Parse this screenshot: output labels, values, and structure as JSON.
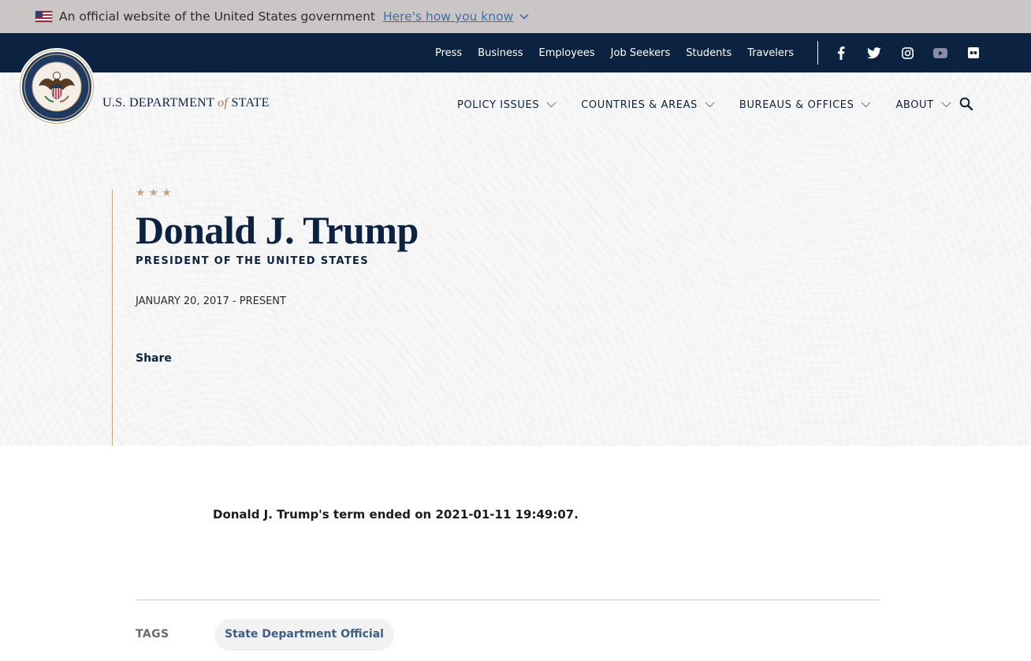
{
  "gov_banner": {
    "text": "An official website of the United States government",
    "link": "Here's how you know"
  },
  "utility_nav": {
    "links": [
      "Press",
      "Business",
      "Employees",
      "Job Seekers",
      "Students",
      "Travelers"
    ],
    "social_icons": [
      "facebook-icon",
      "twitter-icon",
      "instagram-icon",
      "youtube-icon",
      "flickr-icon"
    ]
  },
  "header": {
    "brand_prefix": "U.S. DEPARTMENT",
    "brand_of": "of",
    "brand_suffix": "STATE",
    "nav": [
      "POLICY ISSUES",
      "COUNTRIES & AREAS",
      "BUREAUS & OFFICES",
      "ABOUT"
    ]
  },
  "hero": {
    "stars": "★★★",
    "name": "Donald J. Trump",
    "title": "PRESIDENT OF THE UNITED STATES",
    "term": "JANUARY 20, 2017 - PRESENT",
    "share": "Share"
  },
  "body": {
    "term_ended": "Donald J. Trump's term ended on 2021-01-11 19:49:07."
  },
  "tags": {
    "label": "TAGS",
    "items": [
      "State Department Official"
    ]
  },
  "colors": {
    "navy": "#0b2340",
    "gold": "#c6a579",
    "banner_gray": "#cbc6c6",
    "link_blue": "#3f6fa8"
  }
}
